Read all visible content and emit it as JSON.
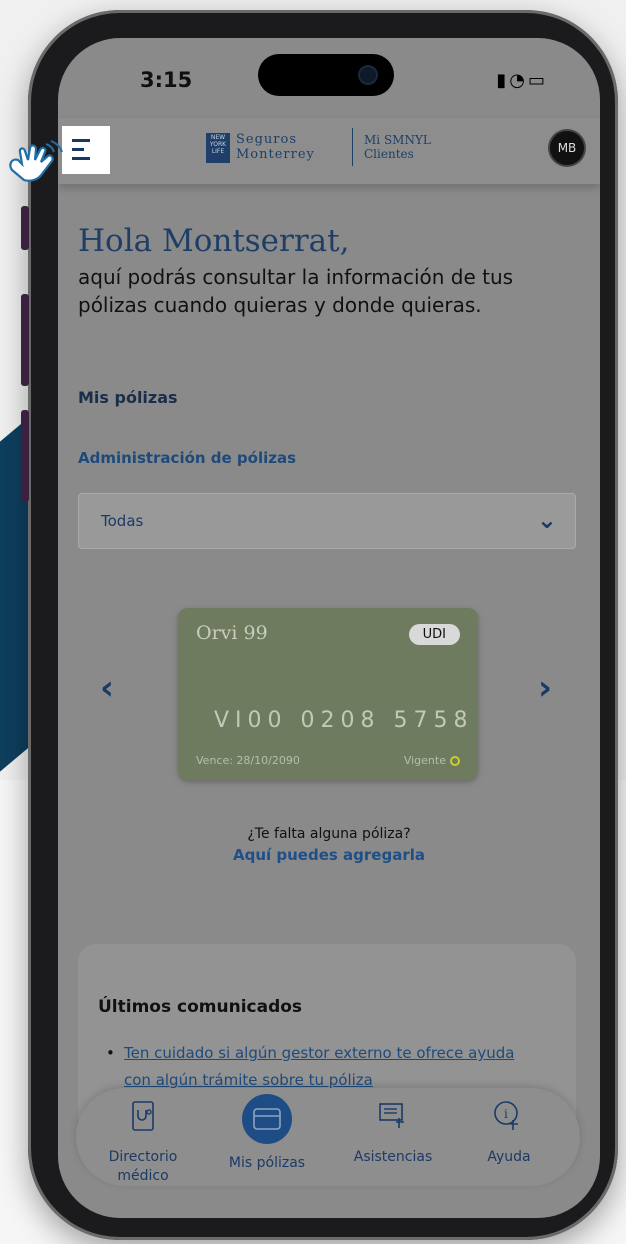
{
  "status_bar": {
    "time": "3:15"
  },
  "header": {
    "logo_mark": "NEW YORK LIFE",
    "logo_name_1": "Seguros",
    "logo_name_2": "Monterrey",
    "logo_sub_1": "Mi SMNYL",
    "logo_sub_2": "Clientes",
    "avatar_initials": "MB"
  },
  "greeting": {
    "title": "Hola Montserrat,",
    "body": "aquí podrás consultar la información de tus pólizas cuando quieras y donde quieras."
  },
  "section_title": "Mis pólizas",
  "admin_label": "Administración de pólizas",
  "filter": {
    "selected": "Todas"
  },
  "policy_card": {
    "name": "Orvi 99",
    "badge": "UDI",
    "number": "VI00 0208 5758",
    "expiry": "Vence: 28/10/2090",
    "status": "Vigente"
  },
  "missing_policy": {
    "question": "¿Te falta alguna póliza?",
    "link": "Aquí puedes agregarla"
  },
  "comunicados": {
    "title": "Últimos comunicados",
    "items": [
      "Ten cuidado si algún gestor externo te ofrece ayuda con algún trámite sobre tu póliza"
    ]
  },
  "tab_bar": {
    "tabs": [
      {
        "label": "Directorio médico",
        "icon": "medical-directory-icon"
      },
      {
        "label": "Mis pólizas",
        "icon": "policy-card-icon",
        "active": true
      },
      {
        "label": "Asistencias",
        "icon": "assistance-icon"
      },
      {
        "label": "Ayuda",
        "icon": "help-icon"
      }
    ]
  },
  "colors": {
    "brand_navy": "#1e4d86",
    "dark_bg_shape": "#0e3f5e",
    "status_ok": "#c8d12a"
  }
}
